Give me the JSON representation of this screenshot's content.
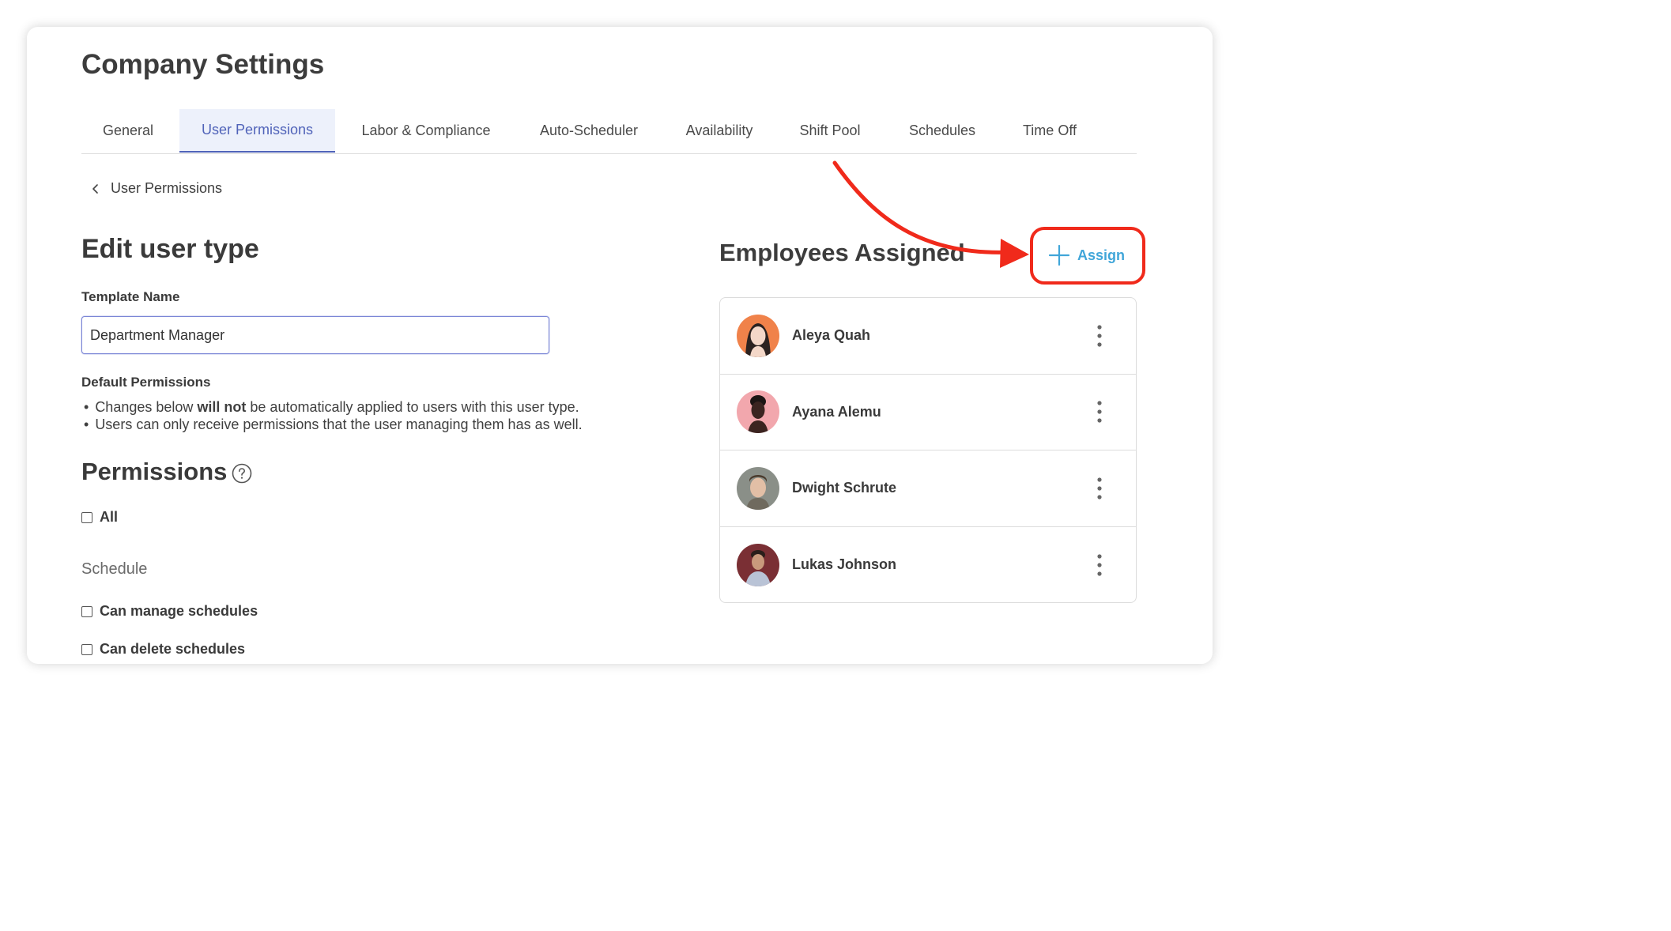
{
  "page": {
    "title": "Company Settings"
  },
  "tabs": [
    {
      "label": "General"
    },
    {
      "label": "User Permissions",
      "active": true
    },
    {
      "label": "Labor & Compliance"
    },
    {
      "label": "Auto-Scheduler"
    },
    {
      "label": "Availability"
    },
    {
      "label": "Shift Pool"
    },
    {
      "label": "Schedules"
    },
    {
      "label": "Time Off"
    }
  ],
  "breadcrumb": {
    "label": "User Permissions",
    "icon": "chevron-left-icon"
  },
  "form": {
    "title": "Edit user type",
    "template_label": "Template Name",
    "template_value": "Department Manager",
    "default_perms_label": "Default Permissions",
    "bullet_1_prefix": "Changes below ",
    "bullet_1_bold": "will not",
    "bullet_1_suffix": " be automatically applied to users with this user type.",
    "bullet_2": "Users can only receive permissions that the user managing them has as well."
  },
  "permissions": {
    "title": "Permissions",
    "help_icon": "question-circle-icon",
    "all_label": "All",
    "schedule_section": "Schedule",
    "items": [
      {
        "label": "Can manage schedules",
        "checked": false
      },
      {
        "label": "Can delete schedules",
        "checked": false
      }
    ]
  },
  "employees": {
    "title": "Employees Assigned",
    "assign_label": "Assign",
    "assign_icon": "plus-icon",
    "list": [
      {
        "name": "Aleya Quah",
        "avatar_bg": "#f0824a"
      },
      {
        "name": "Ayana Alemu",
        "avatar_bg": "#f2a7ad"
      },
      {
        "name": "Dwight Schrute",
        "avatar_bg": "#8a8f88"
      },
      {
        "name": "Lukas Johnson",
        "avatar_bg": "#7a2f34"
      }
    ]
  },
  "colors": {
    "accent": "#5063b9",
    "assign": "#41a6d9",
    "annotation": "#f02a1b"
  }
}
